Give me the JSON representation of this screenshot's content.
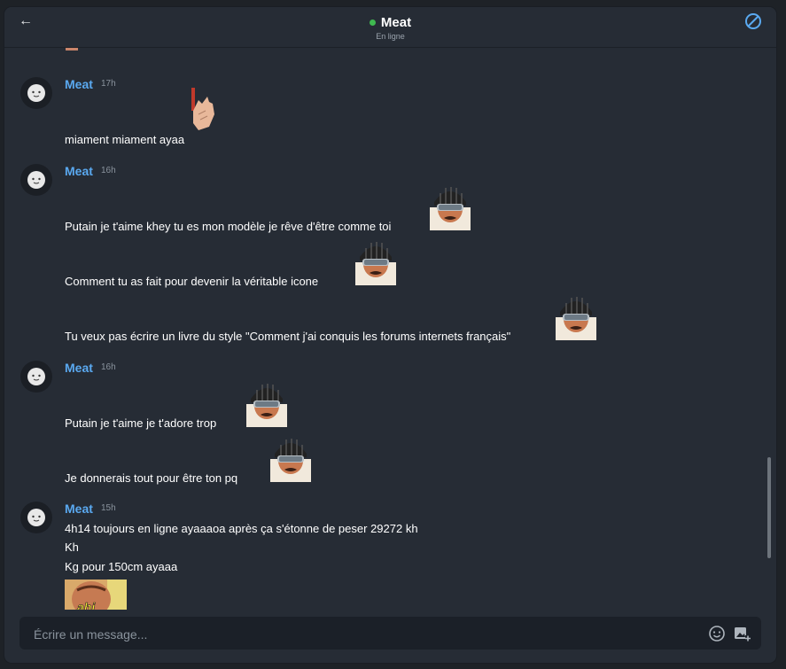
{
  "header": {
    "title": "Meat",
    "status": "En ligne",
    "accent": "#5aa9f0",
    "online_color": "#3fb950"
  },
  "messages": [
    {
      "author": "Meat",
      "time": "17h",
      "lines": [
        "miament miament ayaa"
      ],
      "stickers": [
        "hand-sticker"
      ]
    },
    {
      "author": "Meat",
      "time": "16h",
      "lines": [
        "Putain je t'aime khey tu es mon modèle je rêve d'être comme toi",
        "Comment tu as fait pour devenir la véritable icone",
        "Tu veux pas écrire un livre du style \"Comment j'ai conquis les forums internets français\""
      ],
      "stickers": [
        "helmet-man-sticker",
        "helmet-man-sticker",
        "helmet-man-sticker"
      ]
    },
    {
      "author": "Meat",
      "time": "16h",
      "lines": [
        "Putain je t'aime je t'adore trop",
        "Je donnerais tout pour être ton pq"
      ],
      "stickers": [
        "helmet-man-sticker",
        "helmet-man-sticker"
      ]
    },
    {
      "author": "Meat",
      "time": "15h",
      "lines": [
        "4h14 toujours en ligne ayaaaoa après ça s'étonne de peser 29272 kh",
        "Kh",
        "Kg pour 150cm ayaaa"
      ],
      "stickers": [
        "ahi-sticker"
      ],
      "sticker_text": "ahi"
    }
  ],
  "composer": {
    "placeholder": "Écrire un message..."
  },
  "icons": {
    "back": "arrow-left-icon",
    "block": "block-icon",
    "emoji": "emoji-icon",
    "image": "add-image-icon"
  }
}
